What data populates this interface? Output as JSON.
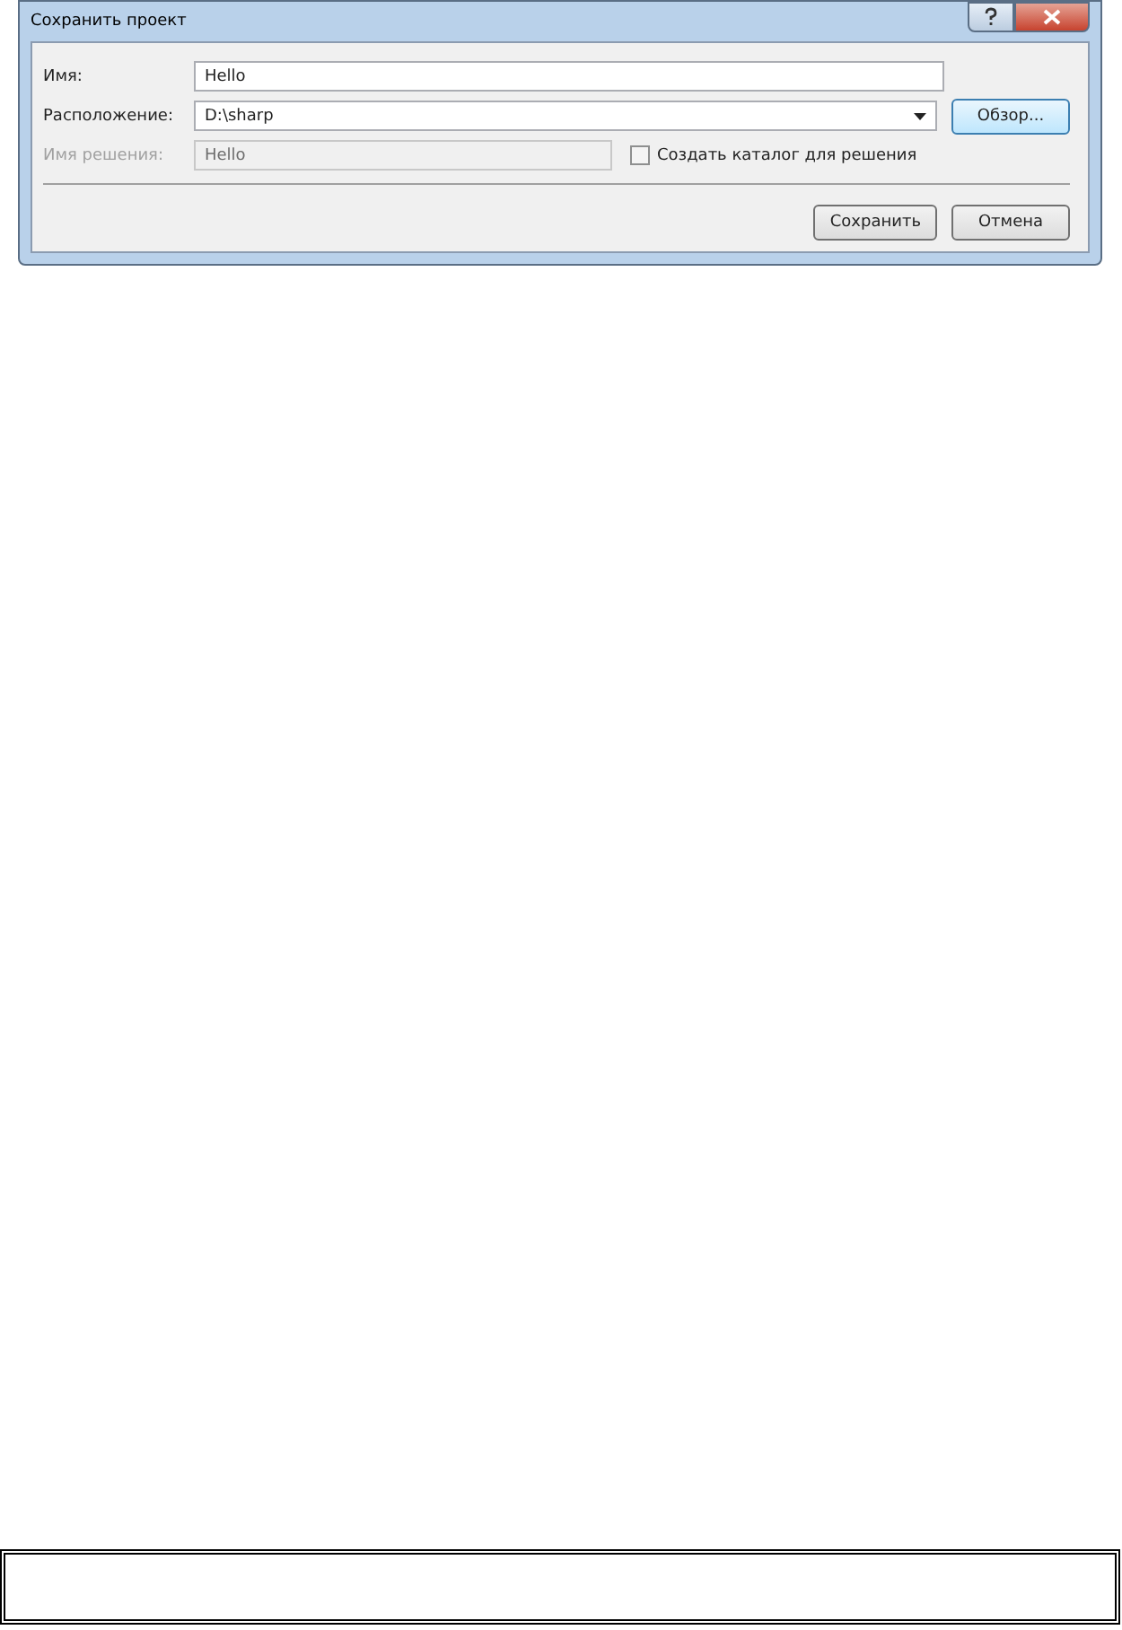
{
  "window": {
    "title": "Сохранить проект"
  },
  "fields": [
    {
      "kind": "text",
      "label": "Имя:",
      "value": "Hello",
      "disabled": false
    },
    {
      "kind": "combo",
      "label": "Расположение:",
      "value": "D:\\sharp",
      "disabled": false
    },
    {
      "kind": "text",
      "label": "Имя решения:",
      "value": "Hello",
      "disabled": true
    }
  ],
  "create_directory": {
    "label": "Создать каталог для решения",
    "checked": false
  },
  "browse_button": "Обзор...",
  "buttons": [
    "Сохранить",
    "Отмена"
  ]
}
